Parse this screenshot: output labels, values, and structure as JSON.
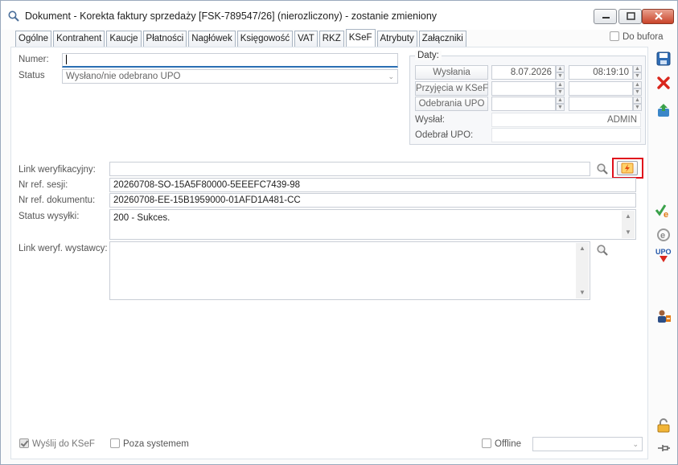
{
  "window": {
    "title": "Dokument - Korekta faktury sprzedaży [FSK-789547/26] (nierozliczony) - zostanie zmieniony"
  },
  "tabs": [
    "Ogólne",
    "Kontrahent",
    "Kaucje",
    "Płatności",
    "Nagłówek",
    "Księgowość",
    "VAT",
    "RKZ",
    "KSeF",
    "Atrybuty",
    "Załączniki"
  ],
  "active_tab": "KSeF",
  "do_bufora": {
    "label": "Do bufora",
    "checked": false
  },
  "form": {
    "numer_label": "Numer:",
    "numer_value": "",
    "status_label": "Status",
    "status_value": "Wysłano/nie odebrano UPO",
    "link_label": "Link weryfikacyjny:",
    "link_value": "",
    "nr_sesji_label": "Nr ref. sesji:",
    "nr_sesji_value": "20260708-SO-15A5F80000-5EEEFC7439-98",
    "nr_dok_label": "Nr ref. dokumentu:",
    "nr_dok_value": "20260708-EE-15B1959000-01AFD1A481-CC",
    "status_wysylki_label": "Status wysyłki:",
    "status_wysylki_value": "200 - Sukces.",
    "link_wystawcy_label": "Link weryf. wystawcy:",
    "link_wystawcy_value": ""
  },
  "daty": {
    "title": "Daty:",
    "wyslania_label": "Wysłania",
    "wyslania_date": "8.07.2026",
    "wyslania_time": "08:19:10",
    "przyjecia_label": "Przyjęcia w KSeF",
    "przyjecia_date": "",
    "przyjecia_time": "",
    "odebrania_label": "Odebrania UPO",
    "odebrania_date": "",
    "odebrania_time": "",
    "wyslal_label": "Wysłał:",
    "wyslal_value": "ADMIN",
    "odebral_label": "Odebrał UPO:",
    "odebral_value": ""
  },
  "footer": {
    "wyslij_label": "Wyślij do KSeF",
    "wyslij_checked": true,
    "poza_label": "Poza systemem",
    "poza_checked": false,
    "offline_label": "Offline",
    "offline_checked": false,
    "offline_select": ""
  },
  "colors": {
    "highlight": "#e0101c",
    "accent_blue": "#2a6fb3"
  },
  "side_icons": [
    "save-icon",
    "cancel-icon",
    "export-icon",
    "accept-e-icon",
    "e-circle-icon",
    "upo-icon",
    "user-swap-icon",
    "unlock-icon",
    "pin-icon"
  ]
}
